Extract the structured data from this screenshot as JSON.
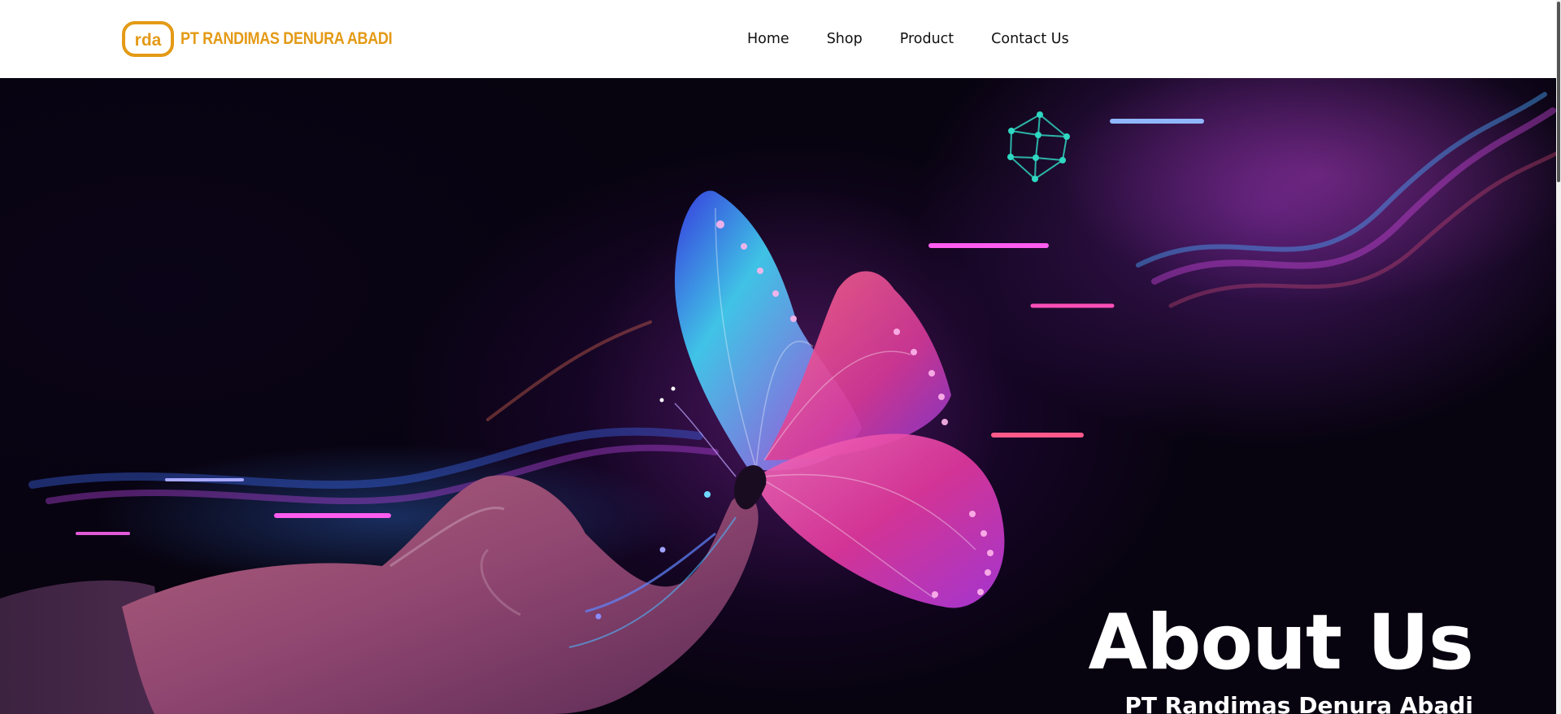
{
  "header": {
    "logo": {
      "icon": "rda-logo-icon",
      "monogram": "rda",
      "company_name": "PT RANDIMAS DENURA ABADI",
      "brand_color": "#e49a16"
    },
    "nav": [
      {
        "label": "Home"
      },
      {
        "label": "Shop"
      },
      {
        "label": "Product"
      },
      {
        "label": "Contact Us"
      }
    ]
  },
  "hero": {
    "image": "butterfly-on-hand-illustration",
    "heading": "About Us",
    "subheading": "PT Randimas Denura Abadi"
  },
  "colors": {
    "header_background": "#ffffff",
    "nav_text": "#111111",
    "hero_background": "#0a0318",
    "hero_text": "#ffffff"
  }
}
